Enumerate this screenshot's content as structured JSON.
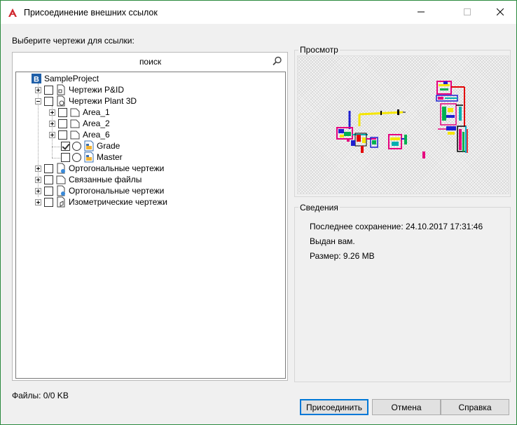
{
  "window": {
    "title": "Присоединение внешних ссылок",
    "accent_color": "#0078d7",
    "app_icon": "autocad-a-icon"
  },
  "left": {
    "select_label": "Выберите чертежи для ссылки:",
    "search_placeholder": "поиск"
  },
  "tree": {
    "root": "SampleProject",
    "items": [
      "Чертежи P&ID",
      "Чертежи Plant 3D",
      "Area_1",
      "Area_2",
      "Area_6",
      "Grade",
      "Master",
      "Ортогональные чертежи",
      "Связанные файлы",
      "Ортогональные чертежи",
      "Изометрические чертежи"
    ],
    "checked": {
      "Grade": true
    }
  },
  "preview": {
    "title": "Просмотр"
  },
  "details": {
    "title": "Сведения",
    "last_saved": "Последнее сохранение: 24.10.2017 17:31:46",
    "issued": "Выдан вам.",
    "size": "Размер: 9.26 MB"
  },
  "footer": {
    "files": "Файлы: 0/0 KB",
    "attach": "Присоединить",
    "cancel": "Отмена",
    "help": "Справка"
  }
}
